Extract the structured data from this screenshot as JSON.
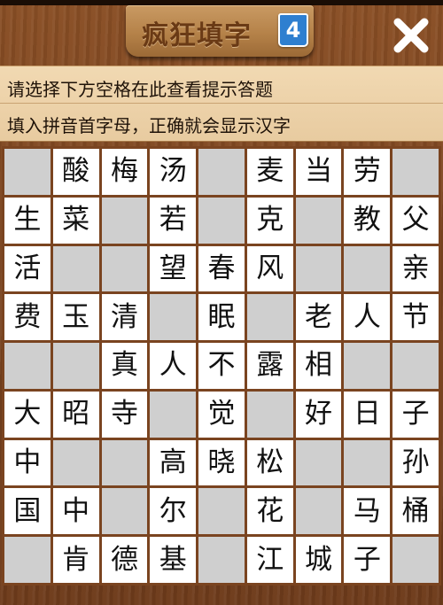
{
  "header": {
    "title": "疯狂填字",
    "level": "4",
    "close_label": "✕"
  },
  "hints": {
    "line1": "请选择下方空格在此查看提示答题",
    "line2": "填入拼音首字母，正确就会显示汉字"
  },
  "colors": {
    "wood": "#7a4420",
    "plaque": "#b58249",
    "title_text": "#6a3a15",
    "badge": "#2e7fd0",
    "hint_panel": "#efd6ae",
    "filled_cell": "#ffffff",
    "blank_cell": "#cfcfcf"
  },
  "board": {
    "rows": [
      [
        "",
        "酸",
        "梅",
        "汤",
        "",
        "麦",
        "当",
        "劳",
        ""
      ],
      [
        "生",
        "菜",
        "",
        "若",
        "",
        "克",
        "",
        "教",
        "父"
      ],
      [
        "活",
        "",
        "",
        "望",
        "春",
        "风",
        "",
        "",
        "亲"
      ],
      [
        "费",
        "玉",
        "清",
        "",
        "眠",
        "",
        "老",
        "人",
        "节"
      ],
      [
        "",
        "",
        "真",
        "人",
        "不",
        "露",
        "相",
        "",
        ""
      ],
      [
        "大",
        "昭",
        "寺",
        "",
        "觉",
        "",
        "好",
        "日",
        "子"
      ],
      [
        "中",
        "",
        "",
        "高",
        "晓",
        "松",
        "",
        "",
        "孙"
      ],
      [
        "国",
        "中",
        "",
        "尔",
        "",
        "花",
        "",
        "马",
        "桶"
      ],
      [
        "",
        "肯",
        "德",
        "基",
        "",
        "江",
        "城",
        "子",
        ""
      ]
    ]
  }
}
